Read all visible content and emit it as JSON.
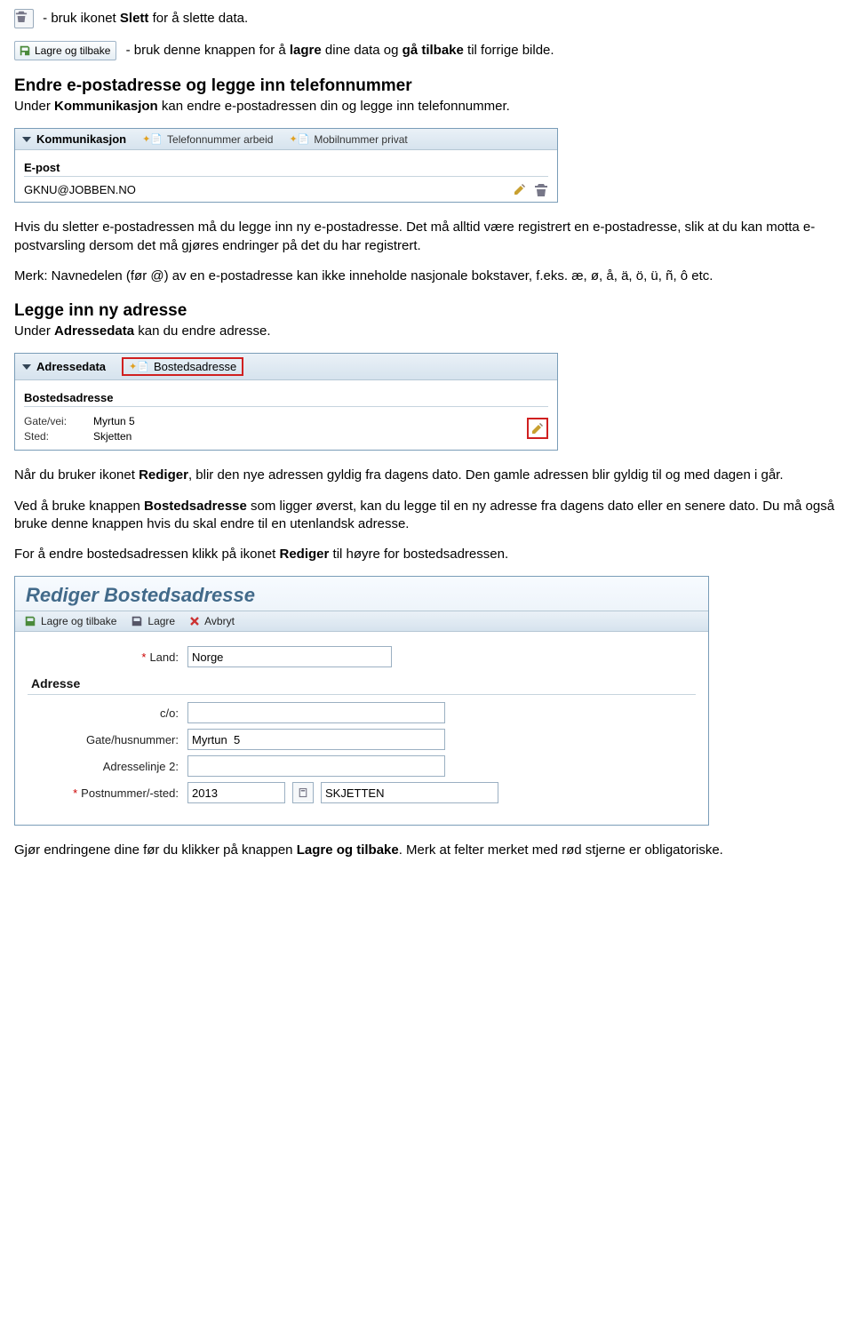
{
  "line1": {
    "pre": " - bruk ikonet ",
    "bold": "Slett",
    "post": " for å slette data."
  },
  "line2": {
    "button_label": "Lagre og tilbake",
    "pre": " - bruk denne knappen for å ",
    "bold1": "lagre",
    "mid": " dine data og ",
    "bold2": "gå tilbake",
    "post": " til forrige bilde."
  },
  "sec1": {
    "heading": "Endre e-postadresse og legge inn telefonnummer",
    "intro_pre": "Under ",
    "intro_bold": "Kommunikasjon",
    "intro_post": " kan endre e-postadressen din og legge inn telefonnummer."
  },
  "panel1": {
    "title": "Kommunikasjon",
    "link1": "Telefonnummer arbeid",
    "link2": "Mobilnummer privat",
    "field_label": "E-post",
    "field_value": "GKNU@JOBBEN.NO"
  },
  "para_after_panel1": "Hvis du sletter e-postadressen må du legge inn ny e-postadresse. Det må alltid være registrert en e-postadresse, slik at du kan motta e-postvarsling dersom det må gjøres endringer på det du har registrert.",
  "para_merk": "Merk: Navnedelen (før @) av en e-postadresse kan ikke inneholde nasjonale bokstaver, f.eks. æ, ø, å, ä, ö, ü, ñ, ô etc.",
  "sec2": {
    "heading": "Legge inn ny adresse",
    "intro_pre": "Under ",
    "intro_bold": "Adressedata",
    "intro_post": " kan du endre adresse."
  },
  "panel2": {
    "title": "Adressedata",
    "link1": "Bostedsadresse",
    "subheading": "Bostedsadresse",
    "gate_label": "Gate/vei:",
    "gate_value": "Myrtun 5",
    "sted_label": "Sted:",
    "sted_value": "Skjetten"
  },
  "para_after_panel2_a_pre": "Når du bruker ikonet ",
  "para_after_panel2_a_bold": "Rediger",
  "para_after_panel2_a_post": ", blir den nye adressen gyldig fra dagens dato. Den gamle adressen blir gyldig til og med dagen i går.",
  "para_after_panel2_b_pre": "Ved å bruke knappen ",
  "para_after_panel2_b_bold": "Bostedsadresse",
  "para_after_panel2_b_post": " som ligger øverst, kan du legge til en ny adresse fra dagens dato eller en senere dato. Du må også bruke denne knappen hvis du skal endre til en utenlandsk adresse.",
  "para_after_panel2_c_pre": "For å endre bostedsadressen klikk på ikonet ",
  "para_after_panel2_c_bold": "Rediger",
  "para_after_panel2_c_post": " til høyre for bostedsadressen.",
  "editor": {
    "title": "Rediger Bostedsadresse",
    "btn_save_back": "Lagre og tilbake",
    "btn_save": "Lagre",
    "btn_cancel": "Avbryt",
    "land_label": "Land:",
    "land_value": "Norge",
    "adresse_section": "Adresse",
    "co_label": "c/o:",
    "co_value": "",
    "gate_label": "Gate/husnummer:",
    "gate_value": "Myrtun  5",
    "adr2_label": "Adresselinje 2:",
    "adr2_value": "",
    "post_label": "Postnummer/-sted:",
    "post_num": "2013",
    "post_city": "SKJETTEN"
  },
  "final_pre": "Gjør endringene dine før du klikker på knappen ",
  "final_bold": "Lagre og tilbake",
  "final_post": ". Merk at felter merket med rød stjerne er obligatoriske."
}
